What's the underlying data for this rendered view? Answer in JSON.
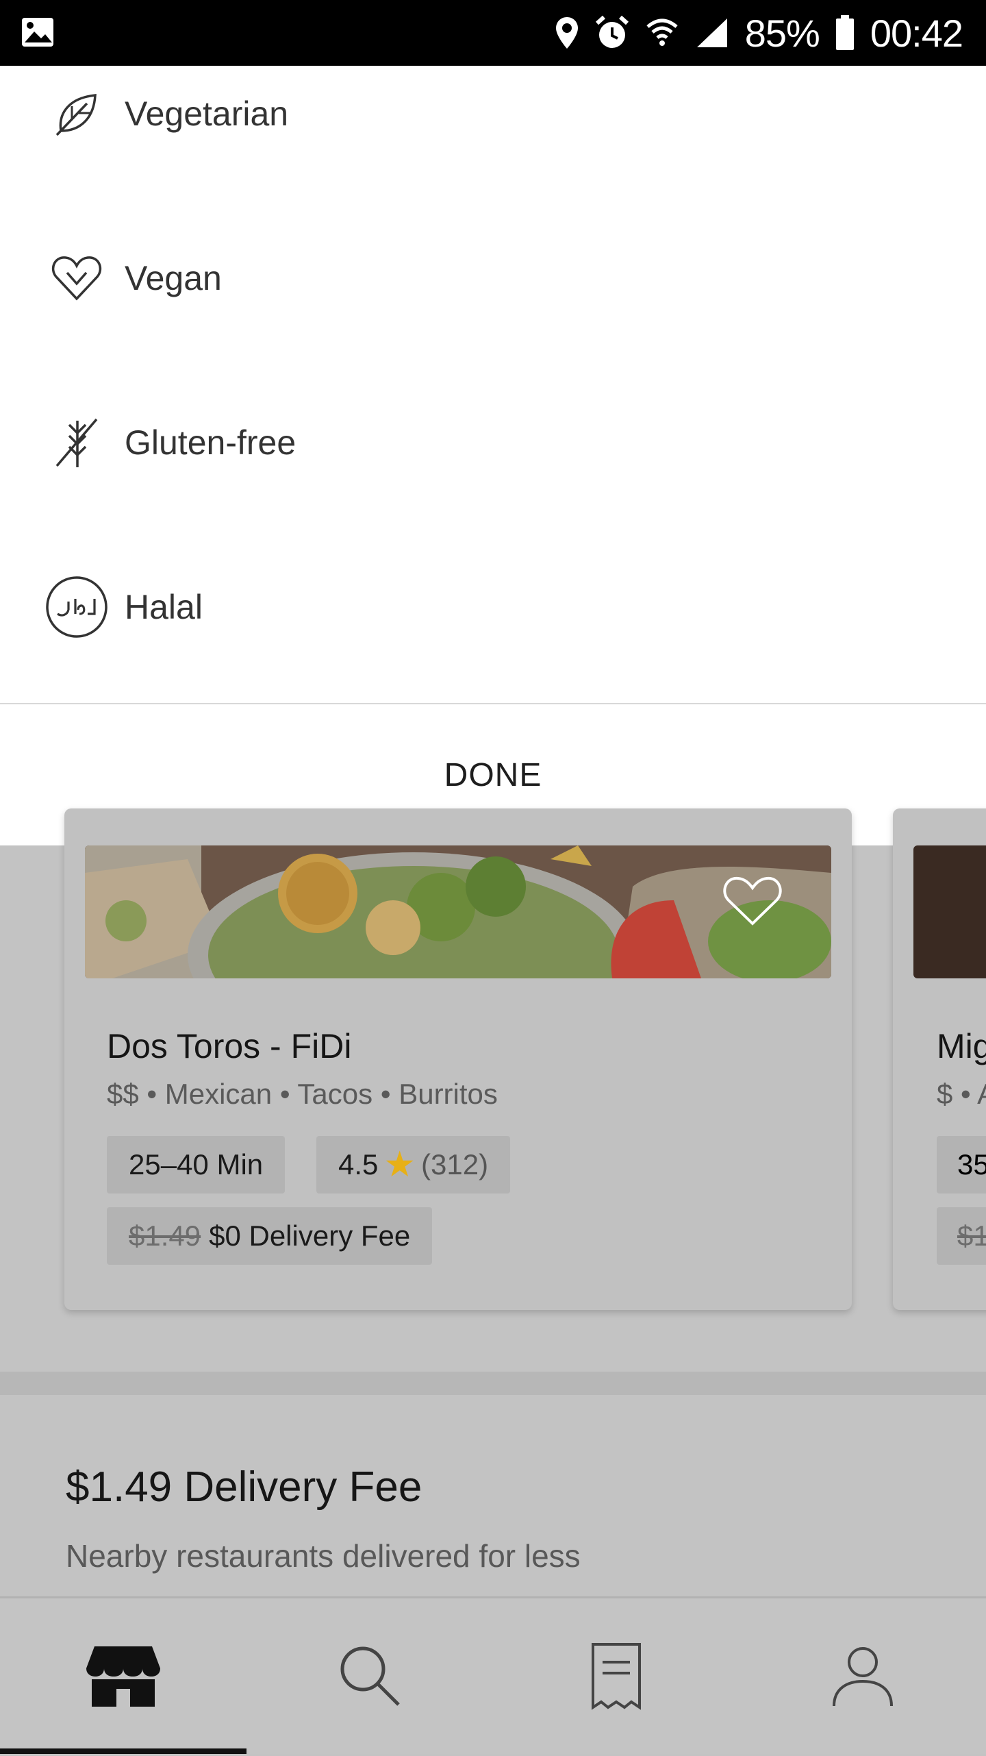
{
  "status_bar": {
    "battery": "85%",
    "time": "00:42",
    "icons": [
      "gallery-icon",
      "location-icon",
      "alarm-icon",
      "wifi-icon",
      "signal-icon",
      "battery-icon"
    ]
  },
  "filters": {
    "items": [
      {
        "label": "Vegetarian",
        "icon": "leaf-icon"
      },
      {
        "label": "Vegan",
        "icon": "heart-leaf-icon"
      },
      {
        "label": "Gluten-free",
        "icon": "wheat-crossed-icon"
      },
      {
        "label": "Halal",
        "icon": "halal-icon"
      }
    ],
    "done_label": "DONE"
  },
  "restaurant_card": {
    "name": "Dos Toros - FiDi",
    "subtitle": "$$ • Mexican • Tacos • Burritos",
    "time": "25–40 Min",
    "rating": "4.5",
    "rating_count": "(312)",
    "old_fee": "$1.49",
    "fee": "$0 Delivery Fee"
  },
  "next_card": {
    "name_partial": "Mig",
    "subtitle_partial": "$ • A",
    "time_partial": "35",
    "fee_partial": "$1"
  },
  "section": {
    "title": "$1.49 Delivery Fee",
    "subtitle": "Nearby restaurants delivered for less"
  },
  "bottom_nav": {
    "items": [
      {
        "name": "home",
        "icon": "store-icon",
        "active": true
      },
      {
        "name": "search",
        "icon": "search-icon",
        "active": false
      },
      {
        "name": "orders",
        "icon": "receipt-icon",
        "active": false
      },
      {
        "name": "account",
        "icon": "person-icon",
        "active": false
      }
    ]
  },
  "colors": {
    "overlay_dim": "#c3c3c3",
    "sheet_bg": "#ffffff",
    "star": "#e7b016",
    "status_bar": "#000000"
  }
}
